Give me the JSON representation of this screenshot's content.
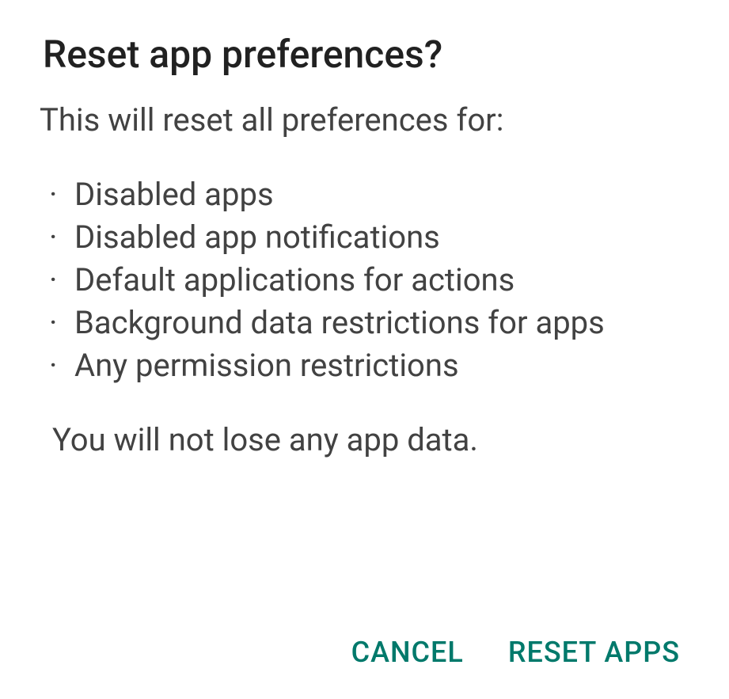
{
  "dialog": {
    "title": "Reset app preferences?",
    "intro": "This will reset all preferences for:",
    "items": [
      "Disabled apps",
      "Disabled app notifications",
      "Default applications for actions",
      "Background data restrictions for apps",
      "Any permission restrictions"
    ],
    "footer": "You will not lose any app data.",
    "cancel_label": "CANCEL",
    "confirm_label": "RESET APPS"
  }
}
